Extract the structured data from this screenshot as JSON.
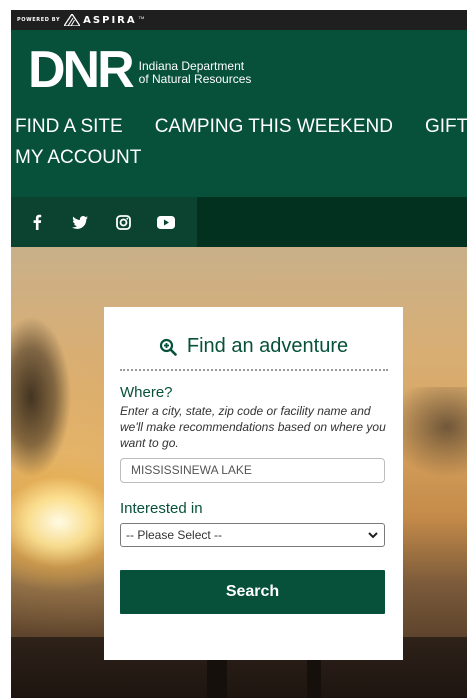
{
  "topbar": {
    "powered_by": "POWERED BY",
    "brand": "ASPIRA",
    "tm": "TM"
  },
  "header": {
    "logo_text": "DNR",
    "org_line1": "Indiana Department",
    "org_line2": "of Natural Resources"
  },
  "nav": {
    "items": [
      "FIND A SITE",
      "CAMPING THIS WEEKEND",
      "GIFT",
      "MY ACCOUNT"
    ]
  },
  "social": {
    "icons": [
      "facebook-icon",
      "twitter-icon",
      "instagram-icon",
      "youtube-icon"
    ],
    "glyphs": [
      "f",
      "",
      "",
      ""
    ]
  },
  "search_card": {
    "title": "Find an adventure",
    "where_label": "Where?",
    "where_hint": "Enter a city, state, zip code or facility name and we'll make recommendations based on where you want to go.",
    "where_value": "MISSISSINEWA LAKE",
    "interest_label": "Interested in",
    "interest_selected": "-- Please Select --",
    "search_button": "Search"
  },
  "colors": {
    "brand_green": "#07513a",
    "dark_green": "#02321f",
    "topbar": "#1f1f1f"
  }
}
